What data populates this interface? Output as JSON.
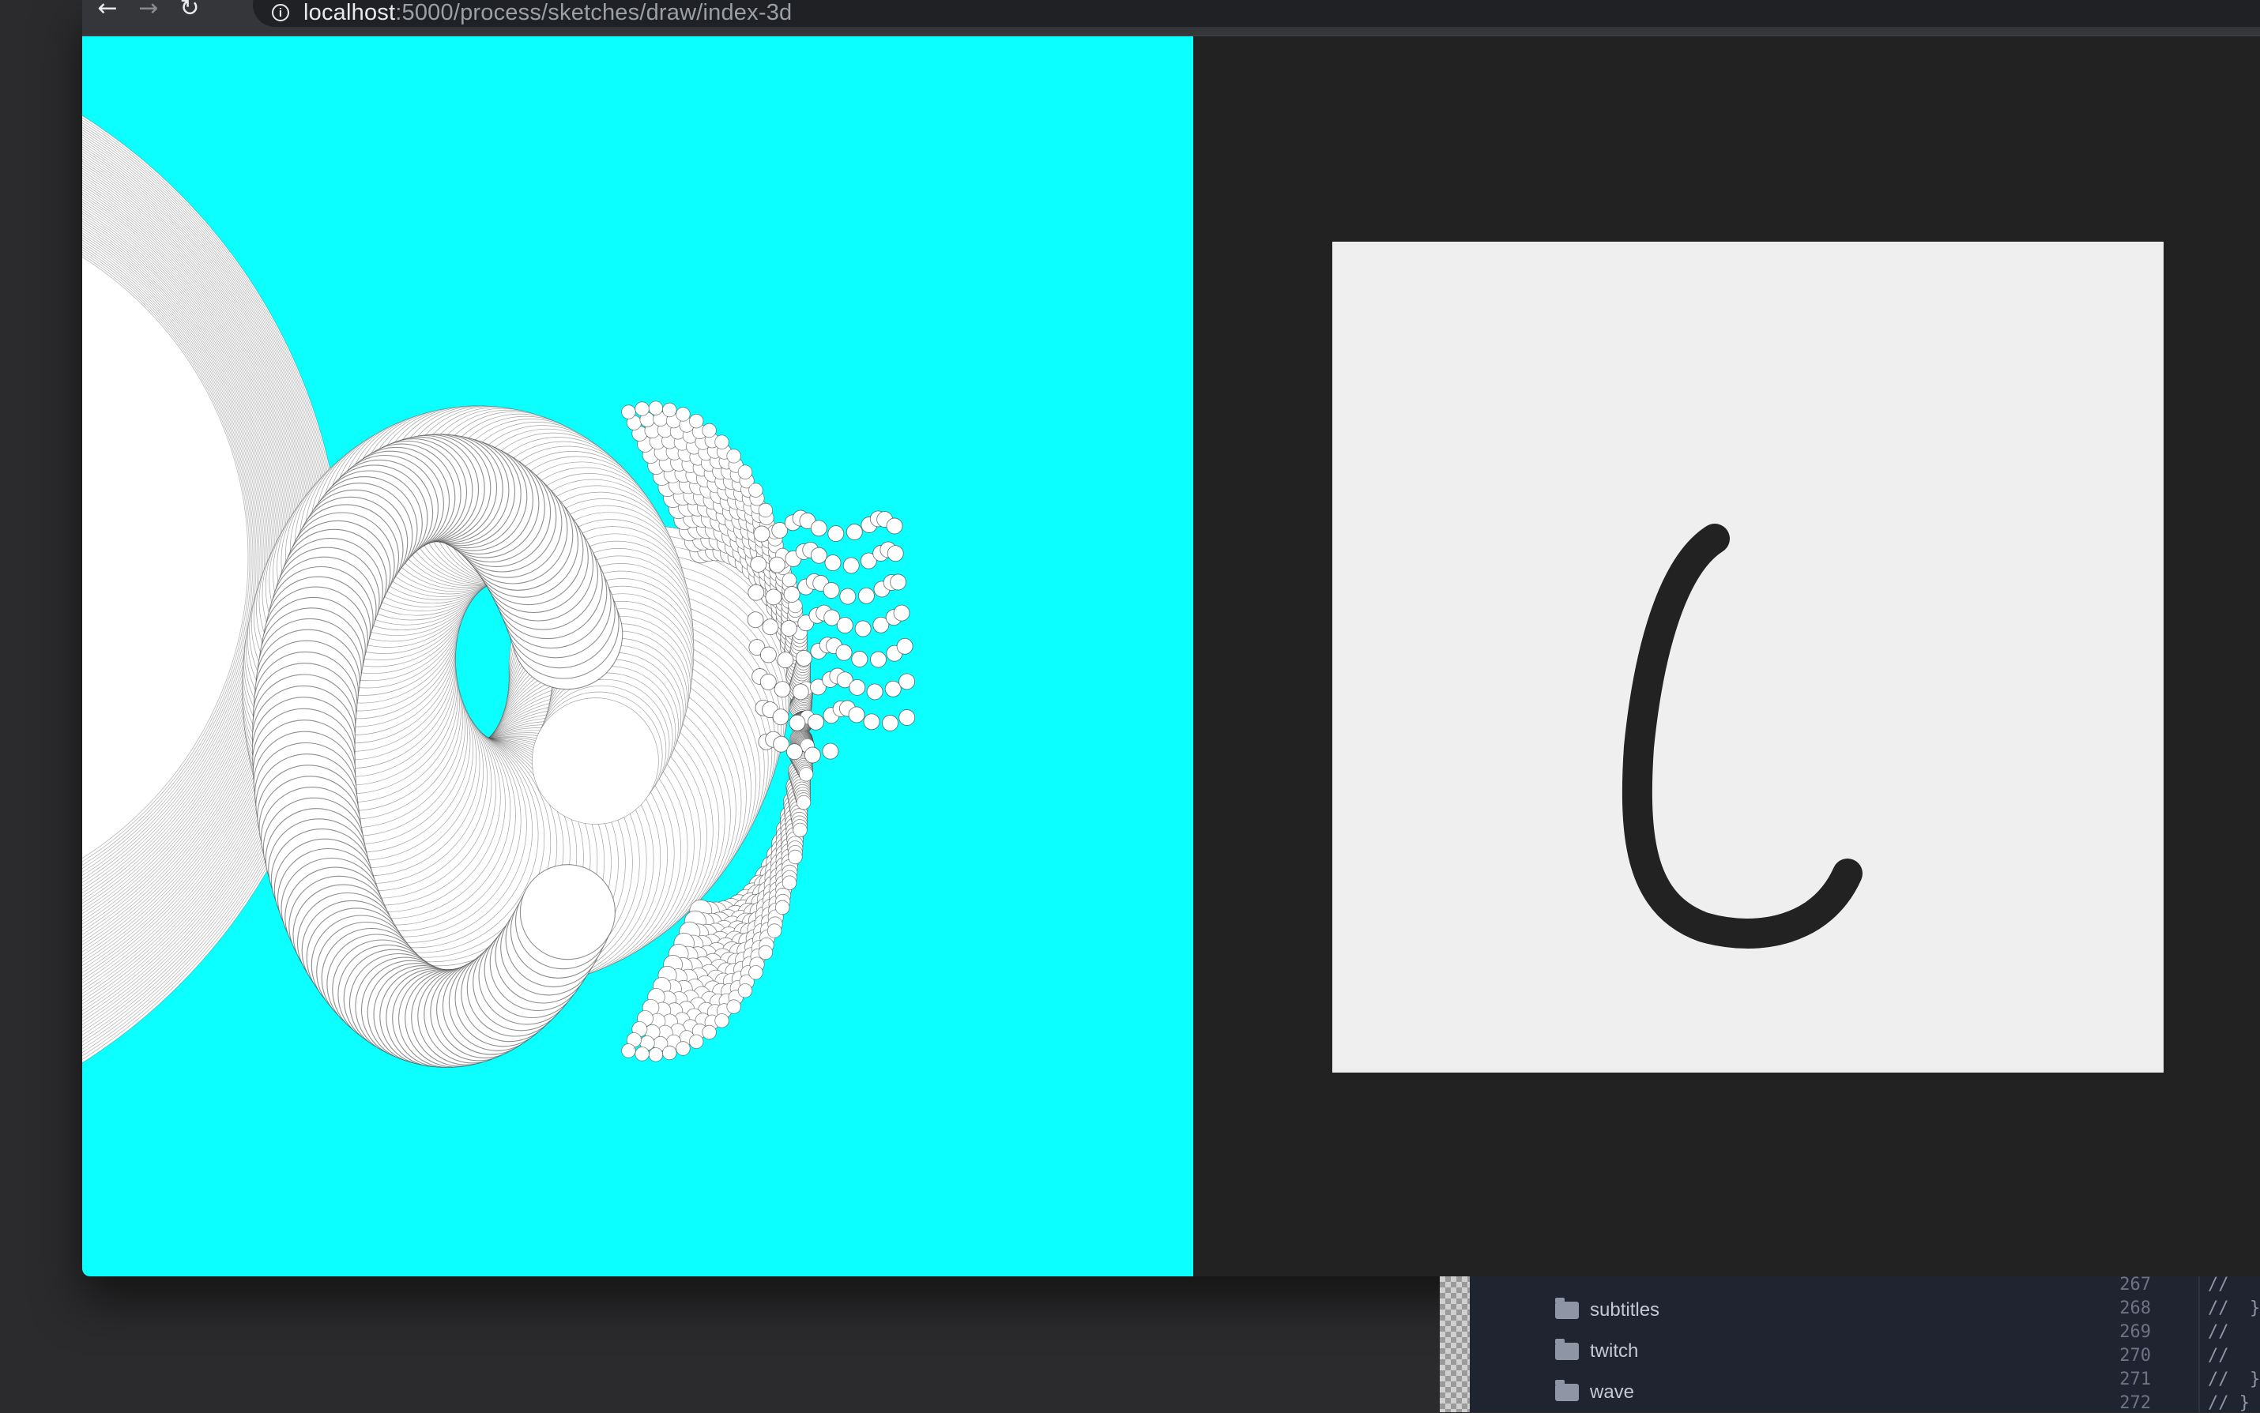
{
  "browser": {
    "url_host": "localhost",
    "url_path": ":5000/process/sketches/draw/index-3d"
  },
  "sketch": {
    "background_color": "#0cffff",
    "stroke_color": "#333333"
  },
  "draw_pad": {
    "background_color": "#efefef",
    "stroke_color": "#222222"
  },
  "editor": {
    "folders": [
      "subtitles",
      "twitch",
      "wave"
    ],
    "line_numbers": [
      "267",
      "268",
      "269",
      "270",
      "271",
      "272"
    ],
    "code_lines": [
      "//",
      "//  }",
      "//",
      "//",
      "//  }",
      "// }"
    ]
  }
}
